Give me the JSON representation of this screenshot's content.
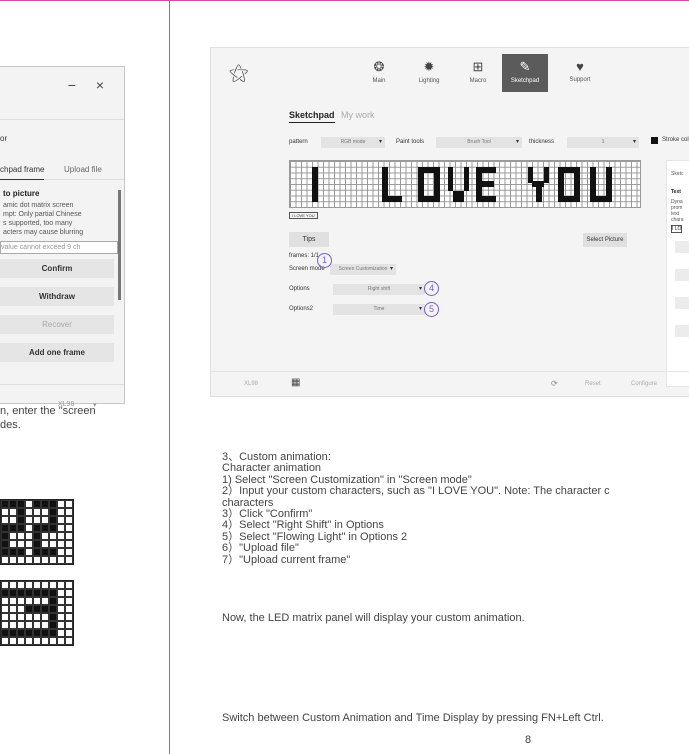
{
  "left": {
    "window_controls": "−  ×",
    "section_label": "or",
    "tabs": [
      "chpad frame",
      "Upload file"
    ],
    "heading": "to picture",
    "desc_lines": [
      "amic dot matrix screen",
      "mpt: Only partial Chinese",
      "s supported, too many",
      "acters may cause blurring"
    ],
    "input_placeholder": "value cannot exceed 9 ch",
    "buttons": {
      "confirm": "Confirm",
      "withdraw": "Withdraw",
      "recover": "Recover",
      "add_frame": "Add one frame"
    },
    "footer_model": "XL98",
    "text_lines": [
      "n, enter the \"screen",
      "des."
    ],
    "matrix_top_on": [
      0,
      1,
      2,
      3,
      4,
      5,
      6,
      7,
      8
    ],
    "matrix_bottom_on": [
      0,
      1,
      2,
      3,
      4,
      5,
      6,
      7,
      8
    ]
  },
  "screenshot": {
    "nav": [
      {
        "label": "Main",
        "icon": "❂"
      },
      {
        "label": "Lighting",
        "icon": "✹"
      },
      {
        "label": "Macro",
        "icon": "⊞"
      },
      {
        "label": "Sketchpad",
        "icon": "✎"
      },
      {
        "label": "Support",
        "icon": "♥"
      }
    ],
    "subtabs": {
      "active": "Sketchpad",
      "other": "My work"
    },
    "controls": {
      "pattern_label": "pattern",
      "pattern_value": "RGB mode",
      "paint_label": "Paint tools",
      "paint_value": "Brush Tool",
      "thickness_label": "thickness",
      "thickness_value": "1",
      "stroke_label": "Stroke col"
    },
    "grid_text": "I LOVE YOU",
    "badge": "I LOVE YOU",
    "panel": {
      "title": "Sketc",
      "heading": "Text",
      "lines": [
        "Dyna",
        "prom",
        "text",
        "chara"
      ],
      "value": "I LO"
    },
    "tips": "Tips",
    "select_picture": "Select Picture",
    "frames": "frames: 1/1",
    "screen_mode_label": "Screen mode",
    "screen_mode_value": "Screen Customization",
    "options_label": "Options",
    "options_value": "Right shift",
    "options2_label": "Options2",
    "options2_value": "Time",
    "markers": [
      "1",
      "4",
      "5"
    ],
    "footer": {
      "model": "XL98",
      "reset": "Reset",
      "configure": "Configure"
    }
  },
  "instructions": {
    "lines": [
      "3、Custom animation:",
      "Character animation",
      "1) Select \"Screen Customization\" in \"Screen mode\"",
      "2）Input your custom characters, such as \"I LOVE YOU\". Note: The character c",
      "characters",
      "3）Click \"Confirm\"",
      "4）Select \"Right Shift\" in Options",
      "5）Select \"Flowing Light\" in Options 2",
      "6）\"Upload file\"",
      "7）\"Upload current frame\""
    ],
    "result": "Now, the LED matrix panel will display your custom animation.",
    "switch_note": "Switch between Custom Animation and Time Display by pressing FN+Left Ctrl.",
    "page_number": "8"
  }
}
